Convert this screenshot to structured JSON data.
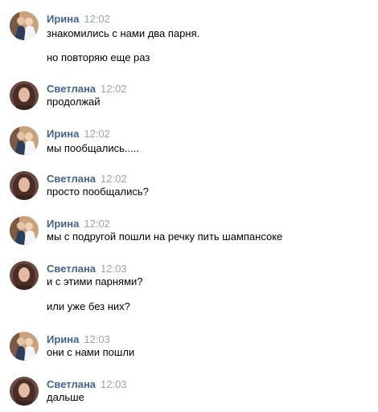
{
  "messages": [
    {
      "author": "Ирина",
      "time": "12:02",
      "avatar": "irina",
      "lines": [
        "знакомились с нами два парня.",
        "но повторяю еще раз"
      ]
    },
    {
      "author": "Светлана",
      "time": "12:02",
      "avatar": "svetlana",
      "lines": [
        "продолжай"
      ]
    },
    {
      "author": "Ирина",
      "time": "12:02",
      "avatar": "irina",
      "lines": [
        "мы пообщались....."
      ]
    },
    {
      "author": "Светлана",
      "time": "12:02",
      "avatar": "svetlana",
      "lines": [
        "просто пообщались?"
      ]
    },
    {
      "author": "Ирина",
      "time": "12:02",
      "avatar": "irina",
      "lines": [
        "мы с подругой пошли на речку пить шампансоке"
      ]
    },
    {
      "author": "Светлана",
      "time": "12:03",
      "avatar": "svetlana",
      "lines": [
        "и с этими парнями?",
        "или уже без них?"
      ]
    },
    {
      "author": "Ирина",
      "time": "12:03",
      "avatar": "irina",
      "lines": [
        "они с нами пошли"
      ]
    },
    {
      "author": "Светлана",
      "time": "12:03",
      "avatar": "svetlana",
      "lines": [
        "дальше"
      ]
    }
  ],
  "colors": {
    "author": "#42648b",
    "time": "#9aa2ab",
    "text": "#000000"
  }
}
